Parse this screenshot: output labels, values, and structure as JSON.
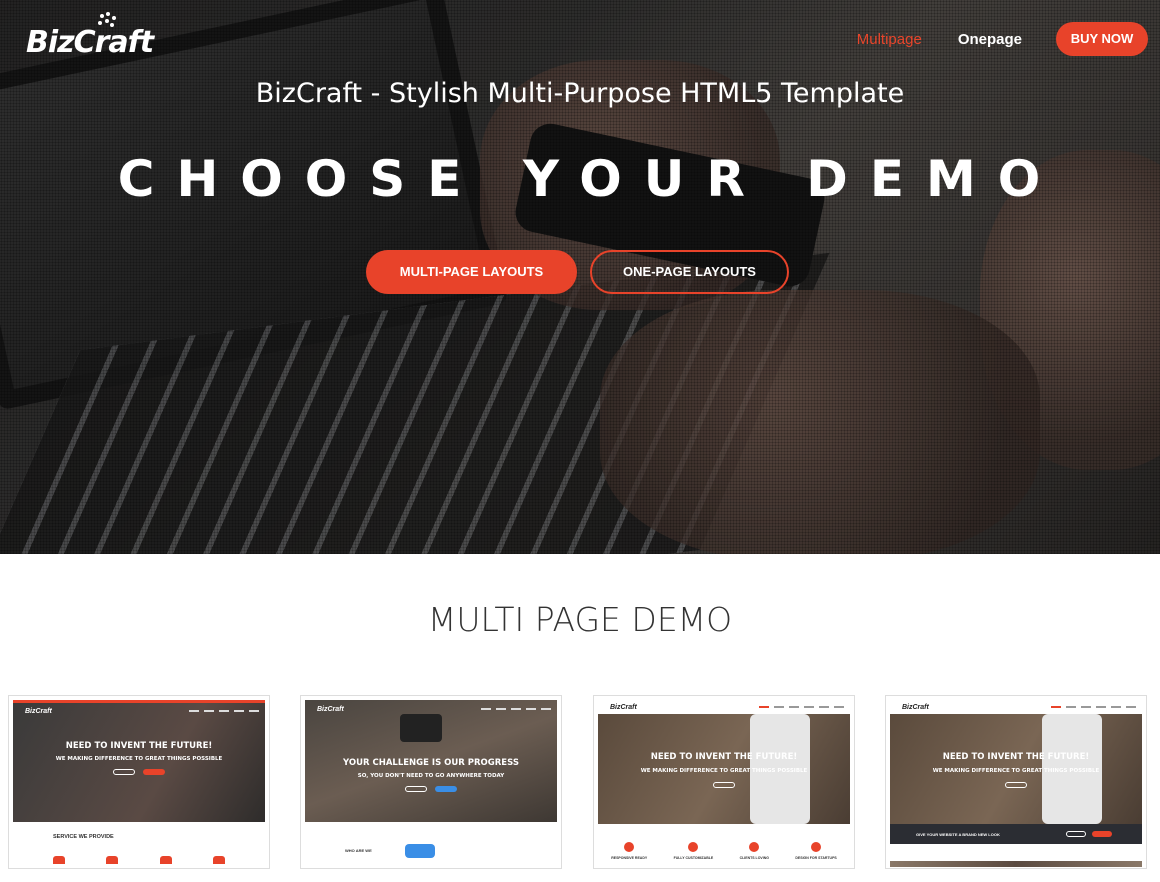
{
  "header": {
    "logo_text": "BizCraft",
    "nav": [
      {
        "label": "Multipage",
        "active": true
      },
      {
        "label": "Onepage",
        "active": false
      }
    ],
    "buy_label": "BUY NOW"
  },
  "hero": {
    "subtitle": "BizCraft - Stylish Multi-Purpose HTML5 Template",
    "headline": "CHOOSE YOUR DEMO",
    "primary_button": "MULTI-PAGE LAYOUTS",
    "secondary_button": "ONE-PAGE LAYOUTS"
  },
  "section": {
    "title": "MULTI PAGE DEMO"
  },
  "demos": [
    {
      "brand": "BizCraft",
      "headline": "NEED TO INVENT THE FUTURE!",
      "tagline": "WE MAKING DIFFERENCE TO GREAT THINGS POSSIBLE",
      "footer_text": "SERVICE WE PROVIDE"
    },
    {
      "brand": "BizCraft",
      "headline": "YOUR CHALLENGE IS OUR PROGRESS",
      "tagline": "SO, YOU DON'T NEED TO GO ANYWHERE TODAY",
      "footer_text": "WHO ARE WE"
    },
    {
      "brand": "BizCraft",
      "headline": "NEED TO INVENT THE FUTURE!",
      "tagline": "WE MAKING DIFFERENCE TO GREAT THINGS POSSIBLE",
      "features": [
        "RESPONSIVE READY",
        "FULLY CUSTOMIZABLE",
        "CLIENTS LOVING",
        "DESIGN FOR STARTUPS"
      ]
    },
    {
      "brand": "BizCraft",
      "headline": "NEED TO INVENT THE FUTURE!",
      "tagline": "WE MAKING DIFFERENCE TO GREAT THINGS POSSIBLE",
      "footer_text": "GIVE YOUR WEBSITE A BRAND NEW LOOK"
    }
  ],
  "colors": {
    "accent": "#e8432a",
    "text_dark": "#333333"
  }
}
